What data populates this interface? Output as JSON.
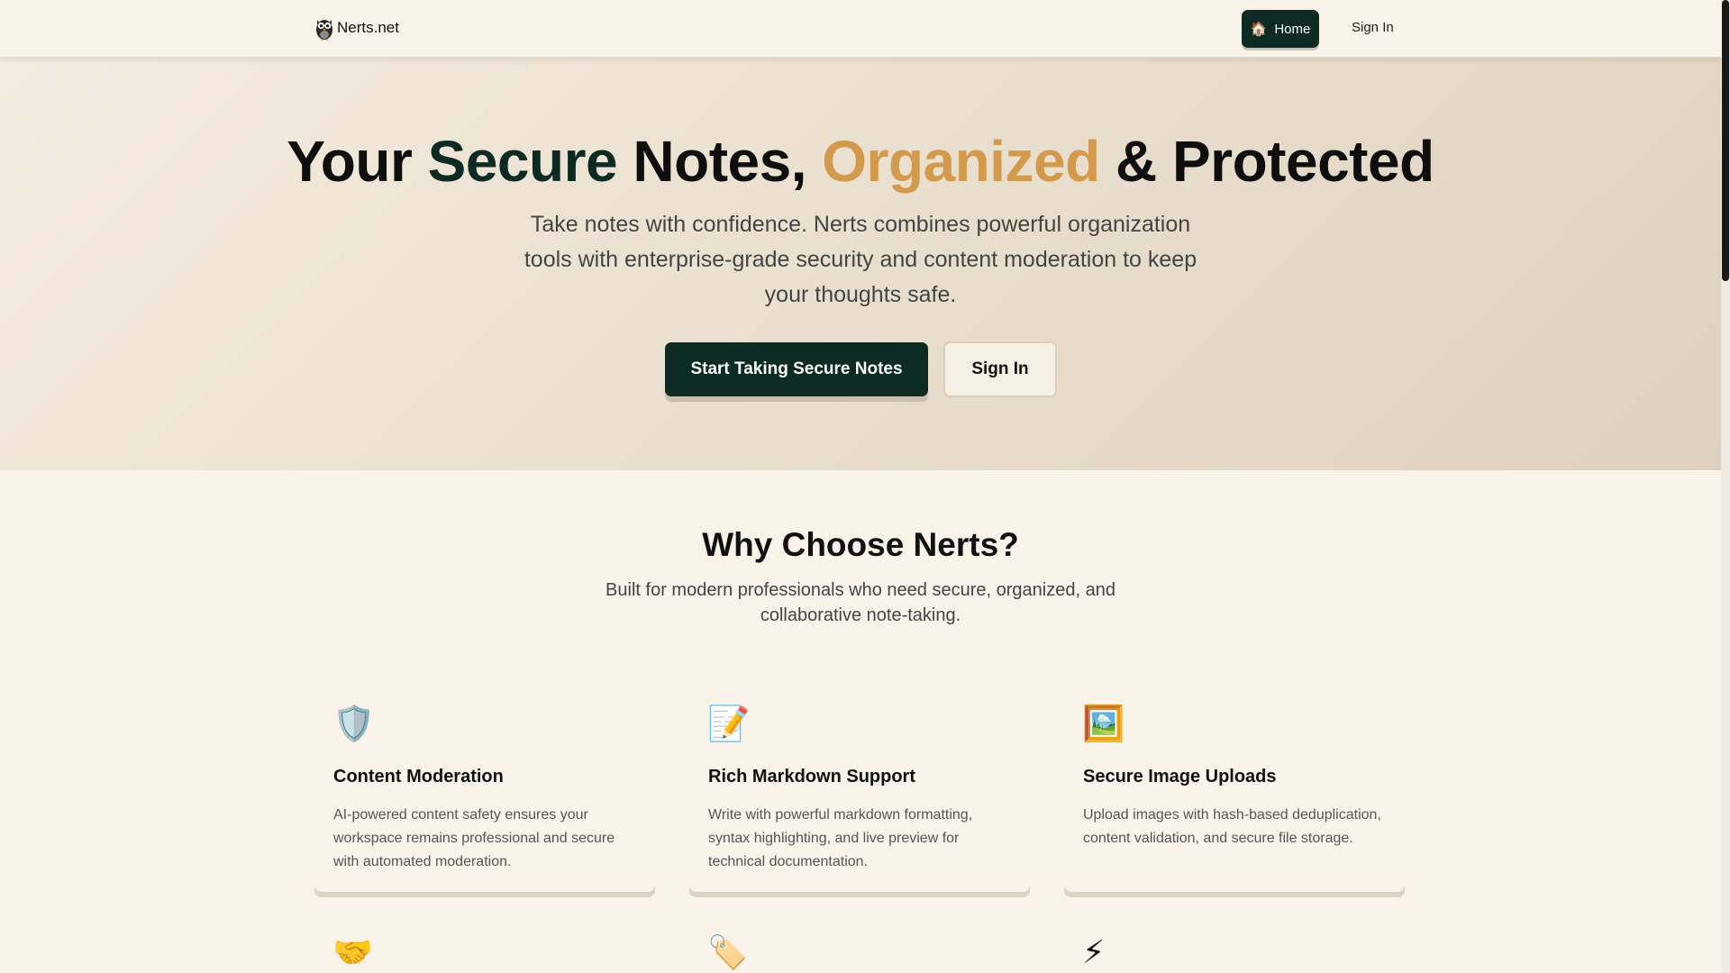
{
  "nav": {
    "brand": "Nerts.net",
    "home_label": "Home",
    "signin_label": "Sign In"
  },
  "hero": {
    "title_part1": "Your ",
    "title_part2": "Secure",
    "title_part3": " Notes, ",
    "title_part4": "Organized",
    "title_part5": " & Protected",
    "subtitle": "Take notes with confidence. Nerts combines powerful organization tools with enterprise-grade security and content moderation to keep your thoughts safe.",
    "primary_button": "Start Taking Secure Notes",
    "secondary_button": "Sign In"
  },
  "why": {
    "title": "Why Choose Nerts?",
    "subtitle": "Built for modern professionals who need secure, organized, and collaborative note-taking."
  },
  "features": [
    {
      "icon": "shield-icon",
      "title": "Content Moderation",
      "description": "AI-powered content safety ensures your workspace remains professional and secure with automated moderation."
    },
    {
      "icon": "memo-icon",
      "title": "Rich Markdown Support",
      "description": "Write with powerful markdown formatting, syntax highlighting, and live preview for technical documentation."
    },
    {
      "icon": "framed-picture-icon",
      "title": "Secure Image Uploads",
      "description": "Upload images with hash-based deduplication, content validation, and secure file storage."
    }
  ],
  "second_row_icons": [
    "handshake-icon",
    "label-tag-icon",
    "lightning-icon"
  ],
  "colors": {
    "primary_dark": "#0d2a23",
    "accent_gold": "#d49a4b",
    "background": "#f9f3ea"
  }
}
